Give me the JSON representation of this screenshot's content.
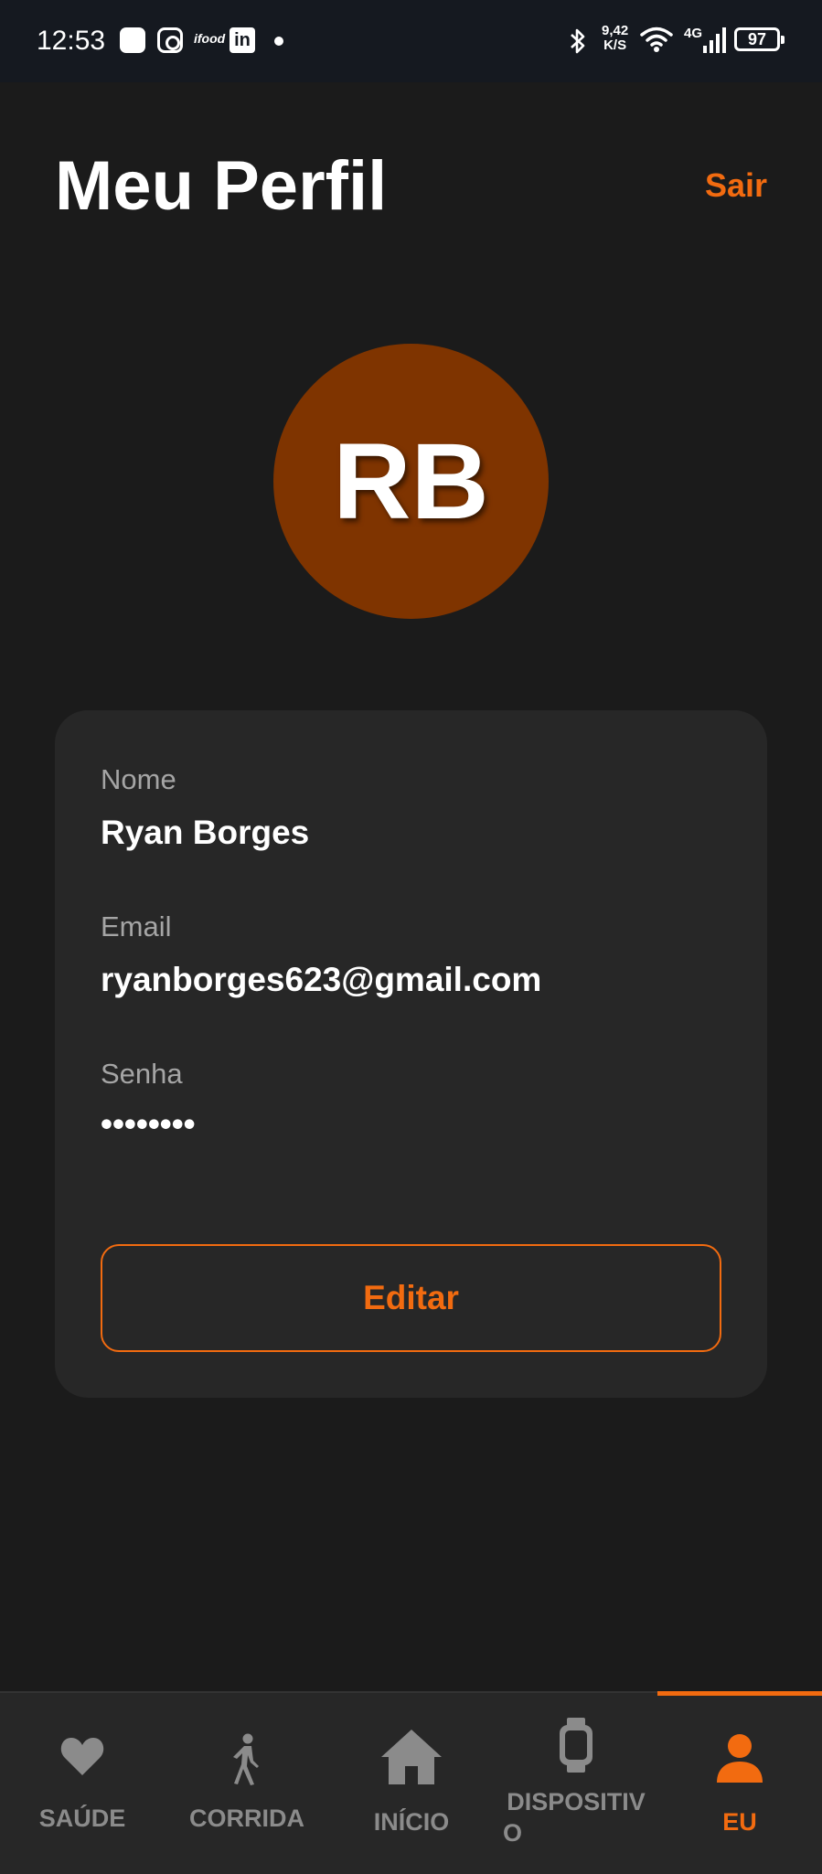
{
  "status_bar": {
    "time": "12:53",
    "net_speed_value": "9,42",
    "net_speed_unit": "K/S",
    "network_type": "4G",
    "battery": "97",
    "ifood": "ifood",
    "linkedin": "in"
  },
  "header": {
    "title": "Meu Perfil",
    "logout_label": "Sair"
  },
  "avatar": {
    "initials": "RB",
    "color": "#7f3400"
  },
  "profile_card": {
    "name_label": "Nome",
    "name_value": "Ryan Borges",
    "email_label": "Email",
    "email_value": "ryanborges623@gmail.com",
    "password_label": "Senha",
    "password_value": "••••••••",
    "edit_label": "Editar"
  },
  "bottom_nav": {
    "active": "eu",
    "items": [
      {
        "id": "saude",
        "label": "SAÚDE",
        "icon": "heart-icon"
      },
      {
        "id": "corrida",
        "label": "CORRIDA",
        "icon": "walking-icon"
      },
      {
        "id": "inicio",
        "label": "INÍCIO",
        "icon": "home-icon"
      },
      {
        "id": "dispositivo",
        "label_line1": "DISPOSITIV",
        "label_line2": "O",
        "icon": "watch-icon"
      },
      {
        "id": "eu",
        "label": "EU",
        "icon": "person-icon"
      }
    ]
  },
  "colors": {
    "accent": "#f26b10",
    "background": "#1b1b1b",
    "card": "#272727",
    "status_bar": "#151920"
  }
}
